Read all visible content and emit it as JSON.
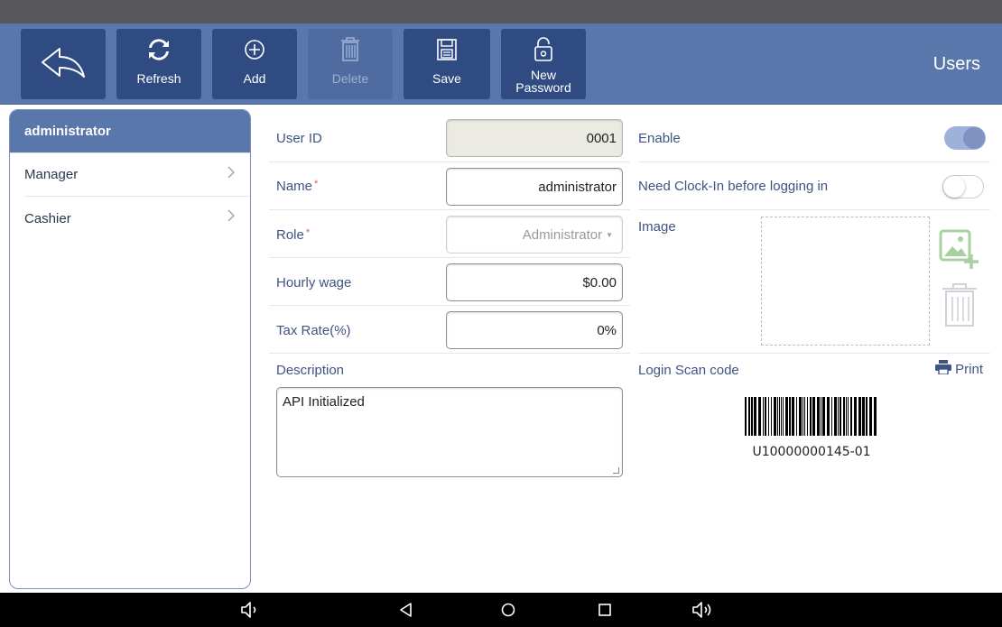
{
  "window": {
    "title": "Users"
  },
  "toolbar": {
    "back_label": "",
    "refresh_label": "Refresh",
    "add_label": "Add",
    "delete_label": "Delete",
    "save_label": "Save",
    "new_password_line1": "New",
    "new_password_line2": "Password"
  },
  "sidebar": {
    "items": [
      {
        "label": "administrator",
        "selected": true
      },
      {
        "label": "Manager",
        "selected": false
      },
      {
        "label": "Cashier",
        "selected": false
      }
    ]
  },
  "form": {
    "user_id_label": "User ID",
    "user_id_value": "0001",
    "name_label": "Name",
    "name_value": "administrator",
    "role_label": "Role",
    "role_value": "Administrator",
    "hourly_wage_label": "Hourly wage",
    "hourly_wage_value": "$0.00",
    "tax_rate_label": "Tax Rate(%)",
    "tax_rate_value": "0%",
    "required_mark": "*",
    "description_label": "Description",
    "description_value": "API Initialized",
    "enable_label": "Enable",
    "enable_on": true,
    "clockin_label": "Need Clock-In before logging in",
    "clockin_on": false,
    "image_label": "Image",
    "login_scan_label": "Login Scan code",
    "print_label": "Print",
    "barcode_value": "U10000000145-01"
  },
  "icons": {
    "back": "back-arrow-icon",
    "refresh": "refresh-icon",
    "add": "add-circle-icon",
    "delete": "trash-icon",
    "save": "floppy-icon",
    "new_password": "unlock-icon",
    "add_image": "add-image-icon",
    "remove_image": "trash-icon",
    "print": "printer-icon"
  },
  "colors": {
    "toolbar": "#5a77ab",
    "button": "#2f4b82",
    "selected_row": "#5a77ab",
    "label_text": "#3f5484",
    "required": "#e05a5a"
  }
}
